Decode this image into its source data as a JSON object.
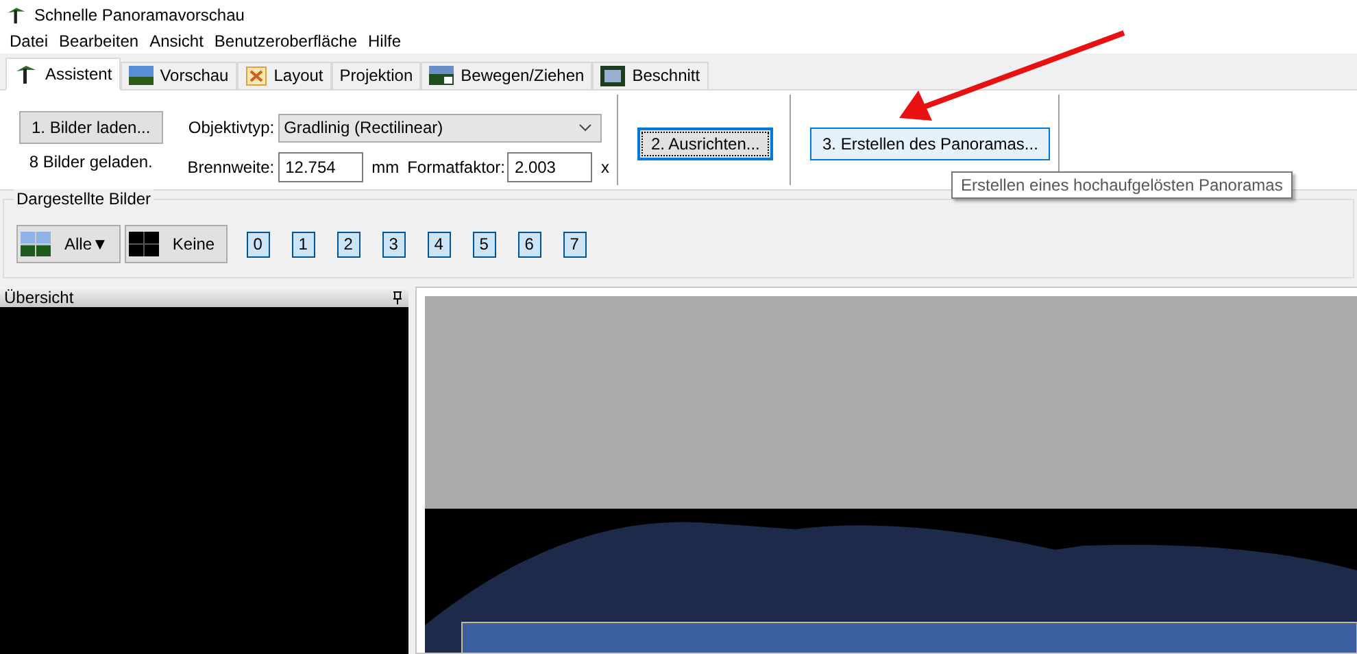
{
  "window": {
    "title": "Schnelle Panoramavorschau"
  },
  "menu": [
    "Datei",
    "Bearbeiten",
    "Ansicht",
    "Benutzeroberfläche",
    "Hilfe"
  ],
  "tabs": [
    {
      "label": "Assistent",
      "selected": true,
      "kind": "wand"
    },
    {
      "label": "Vorschau",
      "selected": false,
      "kind": "gl"
    },
    {
      "label": "Layout",
      "selected": false,
      "kind": "layout"
    },
    {
      "label": "Projektion",
      "selected": false,
      "kind": "none"
    },
    {
      "label": "Bewegen/Ziehen",
      "selected": false,
      "kind": "move"
    },
    {
      "label": "Beschnitt",
      "selected": false,
      "kind": "crop"
    }
  ],
  "assistant": {
    "load_button": "1. Bilder laden...",
    "load_status": "8 Bilder geladen.",
    "lens_label": "Objektivtyp:",
    "lens_value": "Gradlinig (Rectilinear)",
    "focal_label": "Brennweite:",
    "focal_value": "12.754",
    "focal_unit": "mm",
    "crop_label": "Formatfaktor:",
    "crop_value": "2.003",
    "crop_unit": "x",
    "align_button": "2. Ausrichten...",
    "create_button": "3. Erstellen des Panoramas...",
    "tooltip": "Erstellen eines hochaufgelösten Panoramas"
  },
  "displayed_images": {
    "title": "Dargestellte Bilder",
    "all_button": "Alle▼",
    "none_button": "Keine",
    "images": [
      {
        "label": "0",
        "selected": true
      },
      {
        "label": "1",
        "selected": true
      },
      {
        "label": "2",
        "selected": true
      },
      {
        "label": "3",
        "selected": true
      },
      {
        "label": "4",
        "selected": true
      },
      {
        "label": "5",
        "selected": true
      },
      {
        "label": "6",
        "selected": true
      },
      {
        "label": "7",
        "selected": true
      }
    ]
  },
  "overview": {
    "title": "Übersicht"
  }
}
